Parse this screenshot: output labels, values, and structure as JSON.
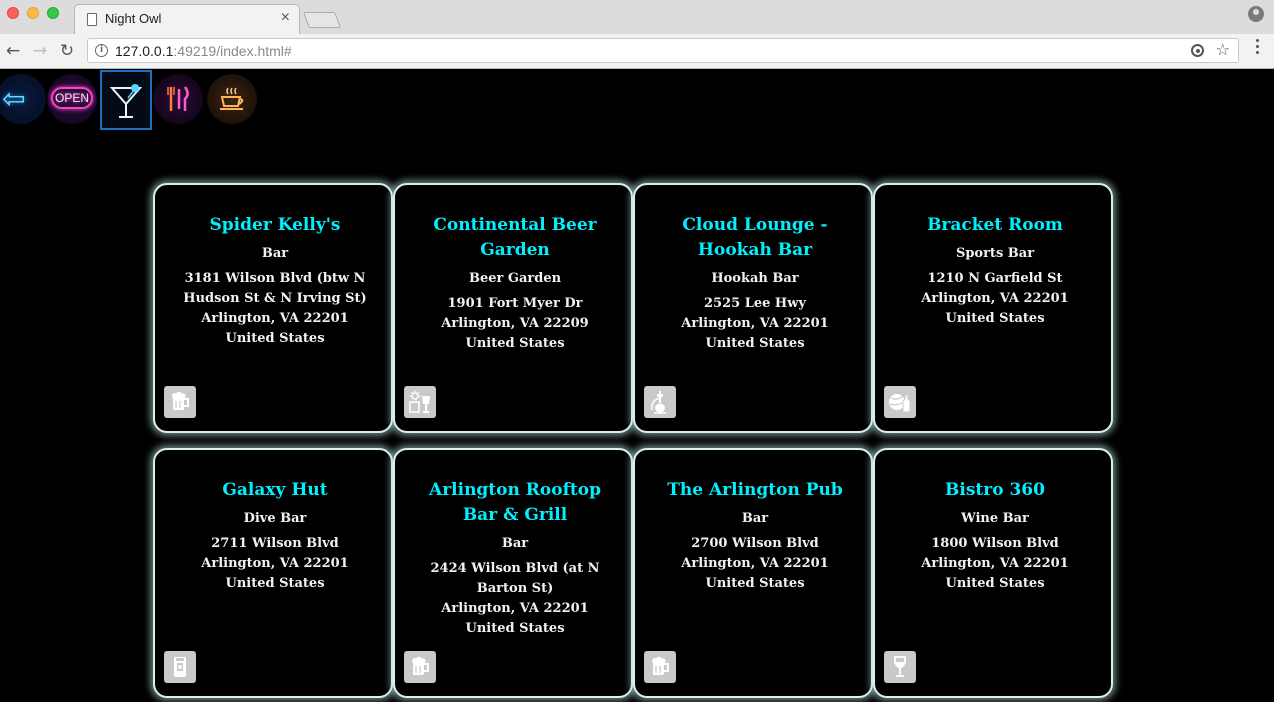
{
  "browser": {
    "tab_title": "Night Owl",
    "tab_close": "×",
    "url_host": "127.0.0.1",
    "url_rest": ":49219/index.html#",
    "back_icon": "arrow-left-icon",
    "forward_icon": "arrow-right-icon",
    "reload_icon": "reload-icon",
    "star_icon": "star-icon"
  },
  "category_nav": [
    {
      "name": "back",
      "icon": "neon-arrow-icon"
    },
    {
      "name": "open",
      "label": "OPEN",
      "icon": "neon-open-sign-icon"
    },
    {
      "name": "bars",
      "icon": "neon-cocktail-icon",
      "selected": true
    },
    {
      "name": "restaurants",
      "icon": "neon-fork-knife-icon"
    },
    {
      "name": "coffee",
      "icon": "neon-coffee-cup-icon"
    }
  ],
  "venues": [
    {
      "name": "Spider Kelly's",
      "type": "Bar",
      "address": "3181 Wilson Blvd (btw N Hudson St & N Irving St)",
      "city": "Arlington, VA 22201",
      "country": "United States",
      "icon": "beer-mug-icon"
    },
    {
      "name": "Continental Beer Garden",
      "type": "Beer Garden",
      "address": "1901 Fort Myer Dr",
      "city": "Arlington, VA 22209",
      "country": "United States",
      "icon": "beer-garden-icon"
    },
    {
      "name": "Cloud Lounge - Hookah Bar",
      "type": "Hookah Bar",
      "address": "2525 Lee Hwy",
      "city": "Arlington, VA 22201",
      "country": "United States",
      "icon": "hookah-icon"
    },
    {
      "name": "Bracket Room",
      "type": "Sports Bar",
      "address": "1210 N Garfield St",
      "city": "Arlington, VA 22201",
      "country": "United States",
      "icon": "sports-bar-icon"
    },
    {
      "name": "Galaxy Hut",
      "type": "Dive Bar",
      "address": "2711 Wilson Blvd",
      "city": "Arlington, VA 22201",
      "country": "United States",
      "icon": "dive-bar-icon"
    },
    {
      "name": "Arlington Rooftop Bar & Grill",
      "type": "Bar",
      "address": "2424 Wilson Blvd (at N Barton St)",
      "city": "Arlington, VA 22201",
      "country": "United States",
      "icon": "beer-mug-icon"
    },
    {
      "name": "The Arlington Pub",
      "type": "Bar",
      "address": "2700 Wilson Blvd",
      "city": "Arlington, VA 22201",
      "country": "United States",
      "icon": "beer-mug-icon"
    },
    {
      "name": "Bistro 360",
      "type": "Wine Bar",
      "address": "1800 Wilson Blvd",
      "city": "Arlington, VA 22201",
      "country": "United States",
      "icon": "wine-glass-icon"
    }
  ]
}
